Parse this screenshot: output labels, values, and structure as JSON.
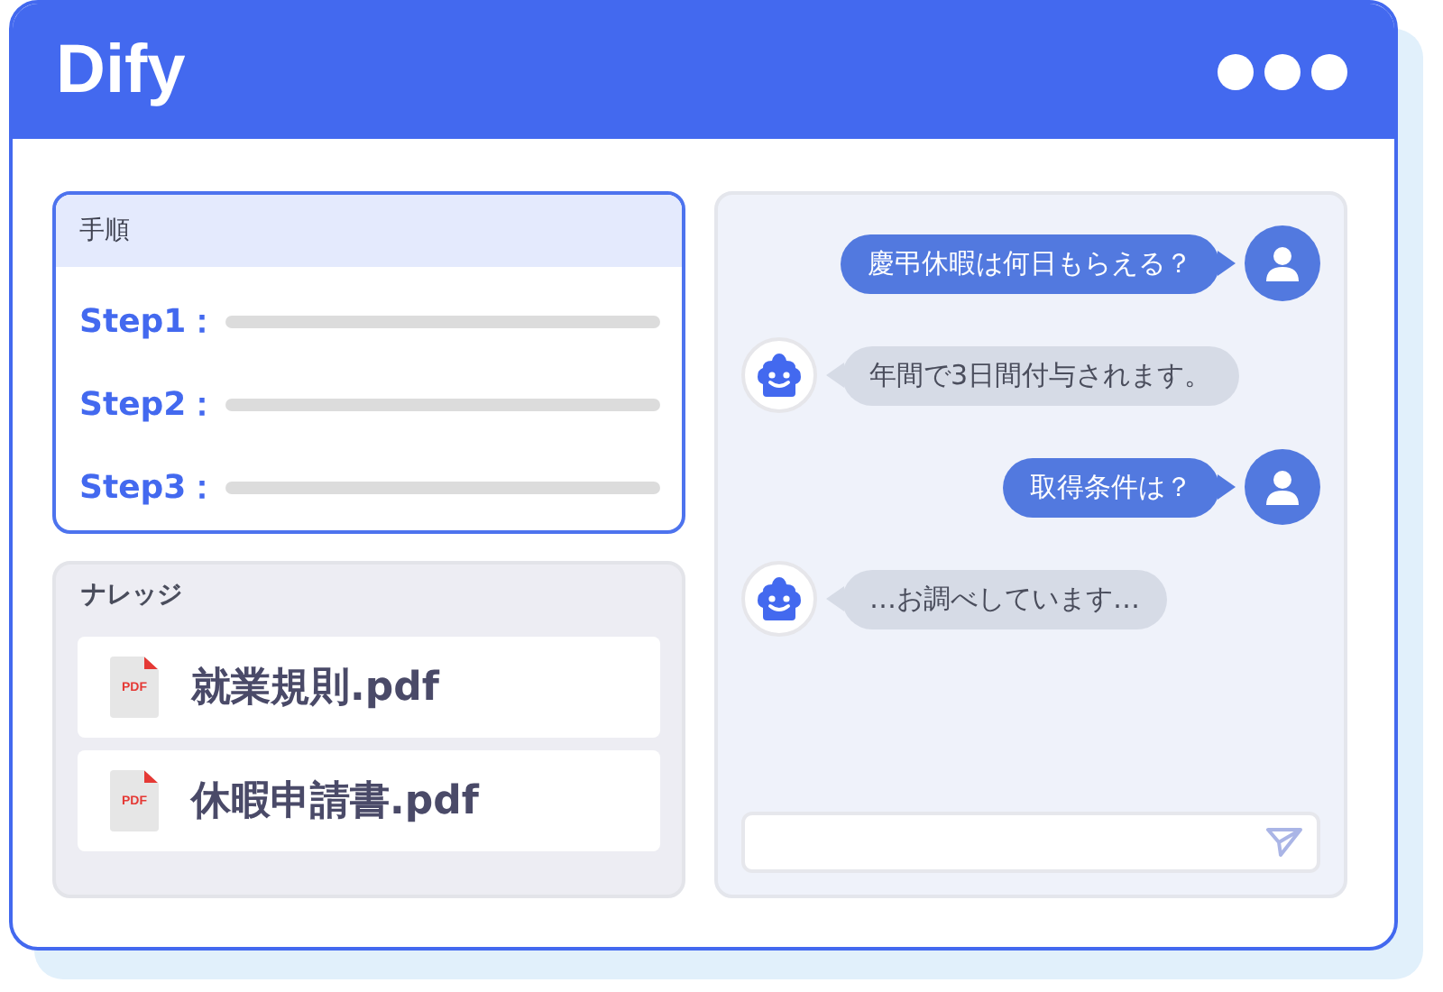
{
  "window": {
    "title": "Dify"
  },
  "steps": {
    "title": "手順",
    "items": [
      {
        "label": "Step1："
      },
      {
        "label": "Step2："
      },
      {
        "label": "Step3："
      }
    ]
  },
  "knowledge": {
    "title": "ナレッジ",
    "files": [
      {
        "badge": "PDF",
        "name": "就業規則.pdf"
      },
      {
        "badge": "PDF",
        "name": "休暇申請書.pdf"
      }
    ]
  },
  "chat": {
    "messages": [
      {
        "kind": "user",
        "text": "慶弔休暇は何日もらえる？"
      },
      {
        "kind": "bot",
        "text": "年間で3日間付与されます。"
      },
      {
        "kind": "user",
        "text": "取得条件は？"
      },
      {
        "kind": "bot",
        "text": "…お調べしています…"
      }
    ]
  }
}
